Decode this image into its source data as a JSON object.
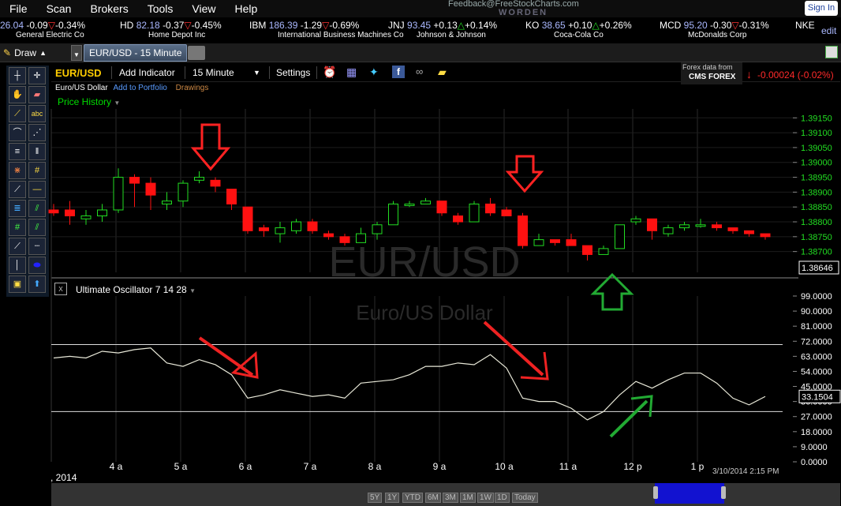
{
  "menu": [
    "File",
    "Scan",
    "Brokers",
    "Tools",
    "View",
    "Help"
  ],
  "feedback": "Feedback@FreeStockCharts.com",
  "worden": "WORDEN",
  "signin": "Sign In",
  "ticker": [
    {
      "sym": "",
      "px": "26.04",
      "chg": "-0.09",
      "dir": "down",
      "pct": "-0.34%",
      "name": "General Electric Co"
    },
    {
      "sym": "HD",
      "px": "82.18",
      "chg": "-0.37",
      "dir": "down",
      "pct": "-0.45%",
      "name": "Home Depot Inc"
    },
    {
      "sym": "IBM",
      "px": "186.39",
      "chg": "-1.29",
      "dir": "down",
      "pct": "-0.69%",
      "name": "International Business Machines Co"
    },
    {
      "sym": "JNJ",
      "px": "93.45",
      "chg": "+0.13",
      "dir": "up",
      "pct": "+0.14%",
      "name": "Johnson & Johnson"
    },
    {
      "sym": "KO",
      "px": "38.65",
      "chg": "+0.10",
      "dir": "up",
      "pct": "+0.26%",
      "name": "Coca-Cola Co"
    },
    {
      "sym": "MCD",
      "px": "95.20",
      "chg": "-0.30",
      "dir": "down",
      "pct": "-0.31%",
      "name": "McDonalds Corp"
    },
    {
      "sym": "NKE",
      "px": "",
      "chg": "",
      "dir": "",
      "pct": "",
      "name": ""
    }
  ],
  "edit": "edit",
  "draw": "Draw",
  "tab": "EUR/USD - 15 Minute",
  "chartbar": {
    "symbol": "EUR/USD",
    "add_indicator": "Add Indicator",
    "interval": "15 Minute",
    "settings": "Settings",
    "fx_line1": "Forex data from",
    "fx_line2": "CMS FOREX",
    "change": "-0.00024 (-0.02%)"
  },
  "subline": {
    "name": "Euro/US Dollar",
    "portfolio": "Add to Portfolio",
    "drawings": "Drawings"
  },
  "price_history": "Price History",
  "watermark": {
    "symbol": "EUR/USD",
    "name": "Euro/US Dollar"
  },
  "oscillator_title": "Ultimate Oscillator 7 14 28",
  "date_partial": ", 2014",
  "timestamp": "3/10/2014 2:15 PM",
  "ranges": [
    "5Y",
    "1Y",
    "YTD",
    "6M",
    "3M",
    "1M",
    "1W",
    "1D",
    "Today"
  ],
  "colors": {
    "up": "#22dd22",
    "down": "#ff1111",
    "accent": "#ffcc00",
    "price_axis": "#22dd22"
  },
  "chart_data": [
    {
      "type": "candlestick",
      "x_ticks": [
        "4 a",
        "5 a",
        "6 a",
        "7 a",
        "8 a",
        "9 a",
        "10 a",
        "11 a",
        "12 p",
        "1 p"
      ],
      "ylim": [
        1.3863,
        1.3918
      ],
      "y_ticks": [
        "1.39150",
        "1.39100",
        "1.39050",
        "1.39000",
        "1.38950",
        "1.38900",
        "1.38850",
        "1.38800",
        "1.38750",
        "1.38700"
      ],
      "last_price": "1.38646",
      "candles": [
        [
          1.3884,
          1.3886,
          1.3882,
          1.3883
        ],
        [
          1.3884,
          1.3887,
          1.3879,
          1.3882
        ],
        [
          1.3881,
          1.3884,
          1.3879,
          1.3882
        ],
        [
          1.3882,
          1.3886,
          1.388,
          1.3884
        ],
        [
          1.3884,
          1.3898,
          1.3883,
          1.3895
        ],
        [
          1.3895,
          1.3896,
          1.3885,
          1.3893
        ],
        [
          1.3893,
          1.3895,
          1.3884,
          1.3889
        ],
        [
          1.3886,
          1.389,
          1.3884,
          1.3887
        ],
        [
          1.3887,
          1.3894,
          1.3885,
          1.3893
        ],
        [
          1.3894,
          1.3897,
          1.3893,
          1.3895
        ],
        [
          1.3894,
          1.3895,
          1.389,
          1.3892
        ],
        [
          1.3891,
          1.3891,
          1.3884,
          1.3886
        ],
        [
          1.3885,
          1.3885,
          1.3876,
          1.3877
        ],
        [
          1.3878,
          1.3879,
          1.3875,
          1.3877
        ],
        [
          1.3876,
          1.388,
          1.3873,
          1.3878
        ],
        [
          1.3877,
          1.3881,
          1.3876,
          1.388
        ],
        [
          1.388,
          1.3881,
          1.3876,
          1.3877
        ],
        [
          1.3876,
          1.3877,
          1.3874,
          1.3875
        ],
        [
          1.3875,
          1.3876,
          1.3872,
          1.3873
        ],
        [
          1.3873,
          1.3878,
          1.3873,
          1.3876
        ],
        [
          1.3876,
          1.388,
          1.3874,
          1.3879
        ],
        [
          1.3879,
          1.3887,
          1.3879,
          1.3886
        ],
        [
          1.3886,
          1.3887,
          1.3885,
          1.3886
        ],
        [
          1.3886,
          1.3888,
          1.3886,
          1.3887
        ],
        [
          1.3887,
          1.3887,
          1.3882,
          1.3883
        ],
        [
          1.3882,
          1.3883,
          1.3879,
          1.388
        ],
        [
          1.388,
          1.3887,
          1.388,
          1.3886
        ],
        [
          1.3886,
          1.3888,
          1.3882,
          1.3883
        ],
        [
          1.3884,
          1.3885,
          1.3882,
          1.3882
        ],
        [
          1.3882,
          1.3883,
          1.3871,
          1.3872
        ],
        [
          1.3872,
          1.3876,
          1.3872,
          1.3874
        ],
        [
          1.3874,
          1.3874,
          1.3872,
          1.3873
        ],
        [
          1.3874,
          1.3876,
          1.3872,
          1.3872
        ],
        [
          1.3872,
          1.3872,
          1.3867,
          1.3869
        ],
        [
          1.3869,
          1.3872,
          1.3869,
          1.3871
        ],
        [
          1.3871,
          1.3879,
          1.3871,
          1.3879
        ],
        [
          1.388,
          1.3882,
          1.3879,
          1.3881
        ],
        [
          1.3881,
          1.3881,
          1.3874,
          1.3877
        ],
        [
          1.3876,
          1.3879,
          1.3875,
          1.3878
        ],
        [
          1.3878,
          1.388,
          1.3877,
          1.3879
        ],
        [
          1.3879,
          1.3881,
          1.3878,
          1.3879
        ],
        [
          1.3879,
          1.388,
          1.3877,
          1.3878
        ],
        [
          1.3878,
          1.3878,
          1.3876,
          1.3877
        ],
        [
          1.3877,
          1.3877,
          1.3875,
          1.3876
        ],
        [
          1.3876,
          1.3876,
          1.3874,
          1.3875
        ]
      ]
    },
    {
      "type": "line",
      "name": "Ultimate Oscillator 7 14 28",
      "ylim": [
        0,
        99
      ],
      "y_ticks": [
        "99.0000",
        "90.0000",
        "81.0000",
        "72.0000",
        "63.0000",
        "54.0000",
        "45.0000",
        "36.0000",
        "27.0000",
        "18.0000",
        "9.0000",
        "0.0000"
      ],
      "levels": [
        70,
        30
      ],
      "last_value": "33.1504",
      "values": [
        62,
        63,
        62,
        66,
        65,
        67,
        68,
        59,
        57,
        61,
        58,
        52,
        38,
        40,
        43,
        41,
        39,
        40,
        38,
        47,
        48,
        49,
        52,
        57,
        57,
        59,
        58,
        64,
        56,
        38,
        36,
        36,
        32,
        25,
        30,
        40,
        48,
        44,
        49,
        53,
        53,
        47,
        38,
        34,
        39
      ]
    }
  ]
}
